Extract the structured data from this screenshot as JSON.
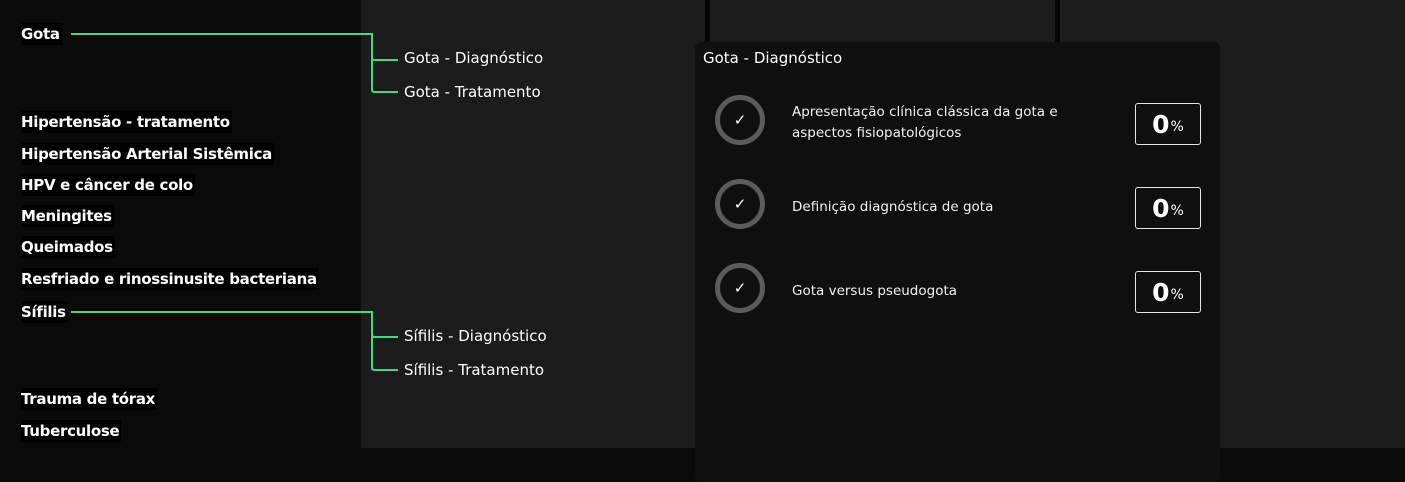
{
  "topics": [
    {
      "label": "Gota"
    },
    {
      "label": "Hipertensão - tratamento"
    },
    {
      "label": "Hipertensão Arterial Sistêmica"
    },
    {
      "label": "HPV e câncer de colo"
    },
    {
      "label": "Meningites"
    },
    {
      "label": "Queimados"
    },
    {
      "label": "Resfriado e rinossinusite bacteriana"
    },
    {
      "label": "Sífilis"
    },
    {
      "label": "Trauma de tórax"
    },
    {
      "label": "Tuberculose"
    }
  ],
  "subtopics": {
    "gota": [
      "Gota - Diagnóstico",
      "Gota - Tratamento"
    ],
    "sifilis": [
      "Sífilis - Diagnóstico",
      "Sífilis - Tratamento"
    ]
  },
  "panel": {
    "title": "Gota - Diagnóstico",
    "items": [
      {
        "label": "Apresentação clínica clássica da gota e aspectos fisiopatológicos",
        "check": "✓",
        "value": "0",
        "unit": "%"
      },
      {
        "label": "Definição diagnóstica de gota",
        "check": "✓",
        "value": "0",
        "unit": "%"
      },
      {
        "label": "Gota versus pseudogota",
        "check": "✓",
        "value": "0",
        "unit": "%"
      }
    ]
  },
  "colors": {
    "accent": "#3ddc84",
    "background": "#0a0a0a",
    "panel": "#1b1b1b",
    "card": "#0f0f0f",
    "ring": "#5b5b5b"
  }
}
